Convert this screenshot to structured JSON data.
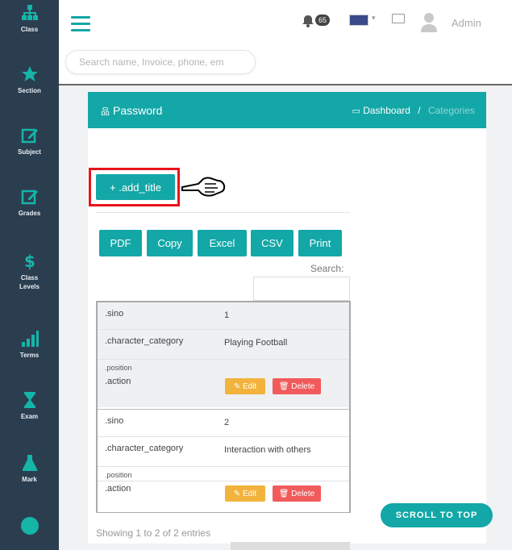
{
  "sidebar": {
    "items": [
      {
        "label": "Class",
        "icon": "sitemap-icon"
      },
      {
        "label": "Section",
        "icon": "star-icon"
      },
      {
        "label": "Subject",
        "icon": "edit-icon"
      },
      {
        "label": "Grades",
        "icon": "edit-icon"
      },
      {
        "label": "Class Levels",
        "icon": "dollar-icon"
      },
      {
        "label": "Terms",
        "icon": "signal-icon"
      },
      {
        "label": "Exam",
        "icon": "hourglass-icon"
      },
      {
        "label": "Mark",
        "icon": "flask-icon"
      }
    ]
  },
  "topbar": {
    "notif_count": "65",
    "user": "Admin",
    "search_placeholder": "Search name, Invoice, phone, em"
  },
  "panel": {
    "title": "Password",
    "breadcrumb_home": "Dashboard",
    "breadcrumb_sep": "/",
    "breadcrumb_current": "Categories",
    "add_label": "+ .add_title"
  },
  "export_buttons": [
    "PDF",
    "Copy",
    "Excel",
    "CSV",
    "Print"
  ],
  "search_label": "Search:",
  "table": {
    "rows": [
      {
        "sino_key": ".sino",
        "sino": "1",
        "cat_key": ".character_category",
        "cat": "Playing Football",
        "pos_key": ".position",
        "action_key": ".action",
        "edit": "Edit",
        "delete": "Delete"
      },
      {
        "sino_key": ".sino",
        "sino": "2",
        "cat_key": ".character_category",
        "cat": "Interaction with others",
        "pos_key": ".position",
        "action_key": ".action",
        "edit": "Edit",
        "delete": "Delete"
      }
    ]
  },
  "showing": "Showing 1 to 2 of 2 entries",
  "scroll_top": "SCROLL TO TOP",
  "colors": {
    "teal": "#13a7a7",
    "sidebar": "#2b3e50",
    "highlight": "#e8141a"
  }
}
